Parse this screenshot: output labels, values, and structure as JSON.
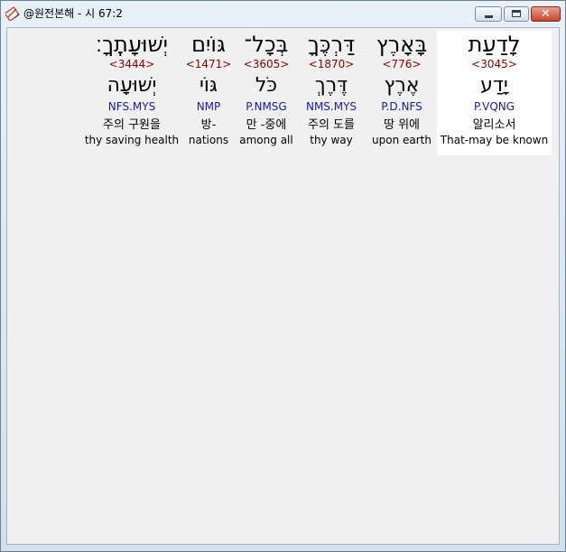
{
  "window": {
    "title": "@원전본해 - 시 67:2"
  },
  "words": [
    {
      "hebrew": "יְשׁוּעָתֶֽךָ׃",
      "strong": "<3444>",
      "lemma": "יְשׁוּעָה",
      "parse": "NFS.MYS",
      "korean": "주의 구원을",
      "english": "thy saving health"
    },
    {
      "hebrew": "גּוֹיִם",
      "strong": "<1471>",
      "lemma": "גּוֹי",
      "parse": "NMP",
      "korean": "방-",
      "english": "nations"
    },
    {
      "hebrew": "בְּכָל־",
      "strong": "<3605>",
      "lemma": "כֹּל",
      "parse": "P.NMSG",
      "korean": "만 -중에",
      "english": "among all"
    },
    {
      "hebrew": "דַּרְכֶּךָ",
      "strong": "<1870>",
      "lemma": "דֶּרֶךְ",
      "parse": "NMS.MYS",
      "korean": "주의 도를",
      "english": "thy way"
    },
    {
      "hebrew": "בָּאָרֶץ",
      "strong": "<776>",
      "lemma": "אֶרֶץ",
      "parse": "P.D.NFS",
      "korean": "땅 위에",
      "english": "upon earth"
    },
    {
      "hebrew": "לָדַעַת",
      "strong": "<3045>",
      "lemma": "יָדַע",
      "parse": "P.VQNG",
      "korean": "알리소서",
      "english": "That-may be known"
    }
  ]
}
